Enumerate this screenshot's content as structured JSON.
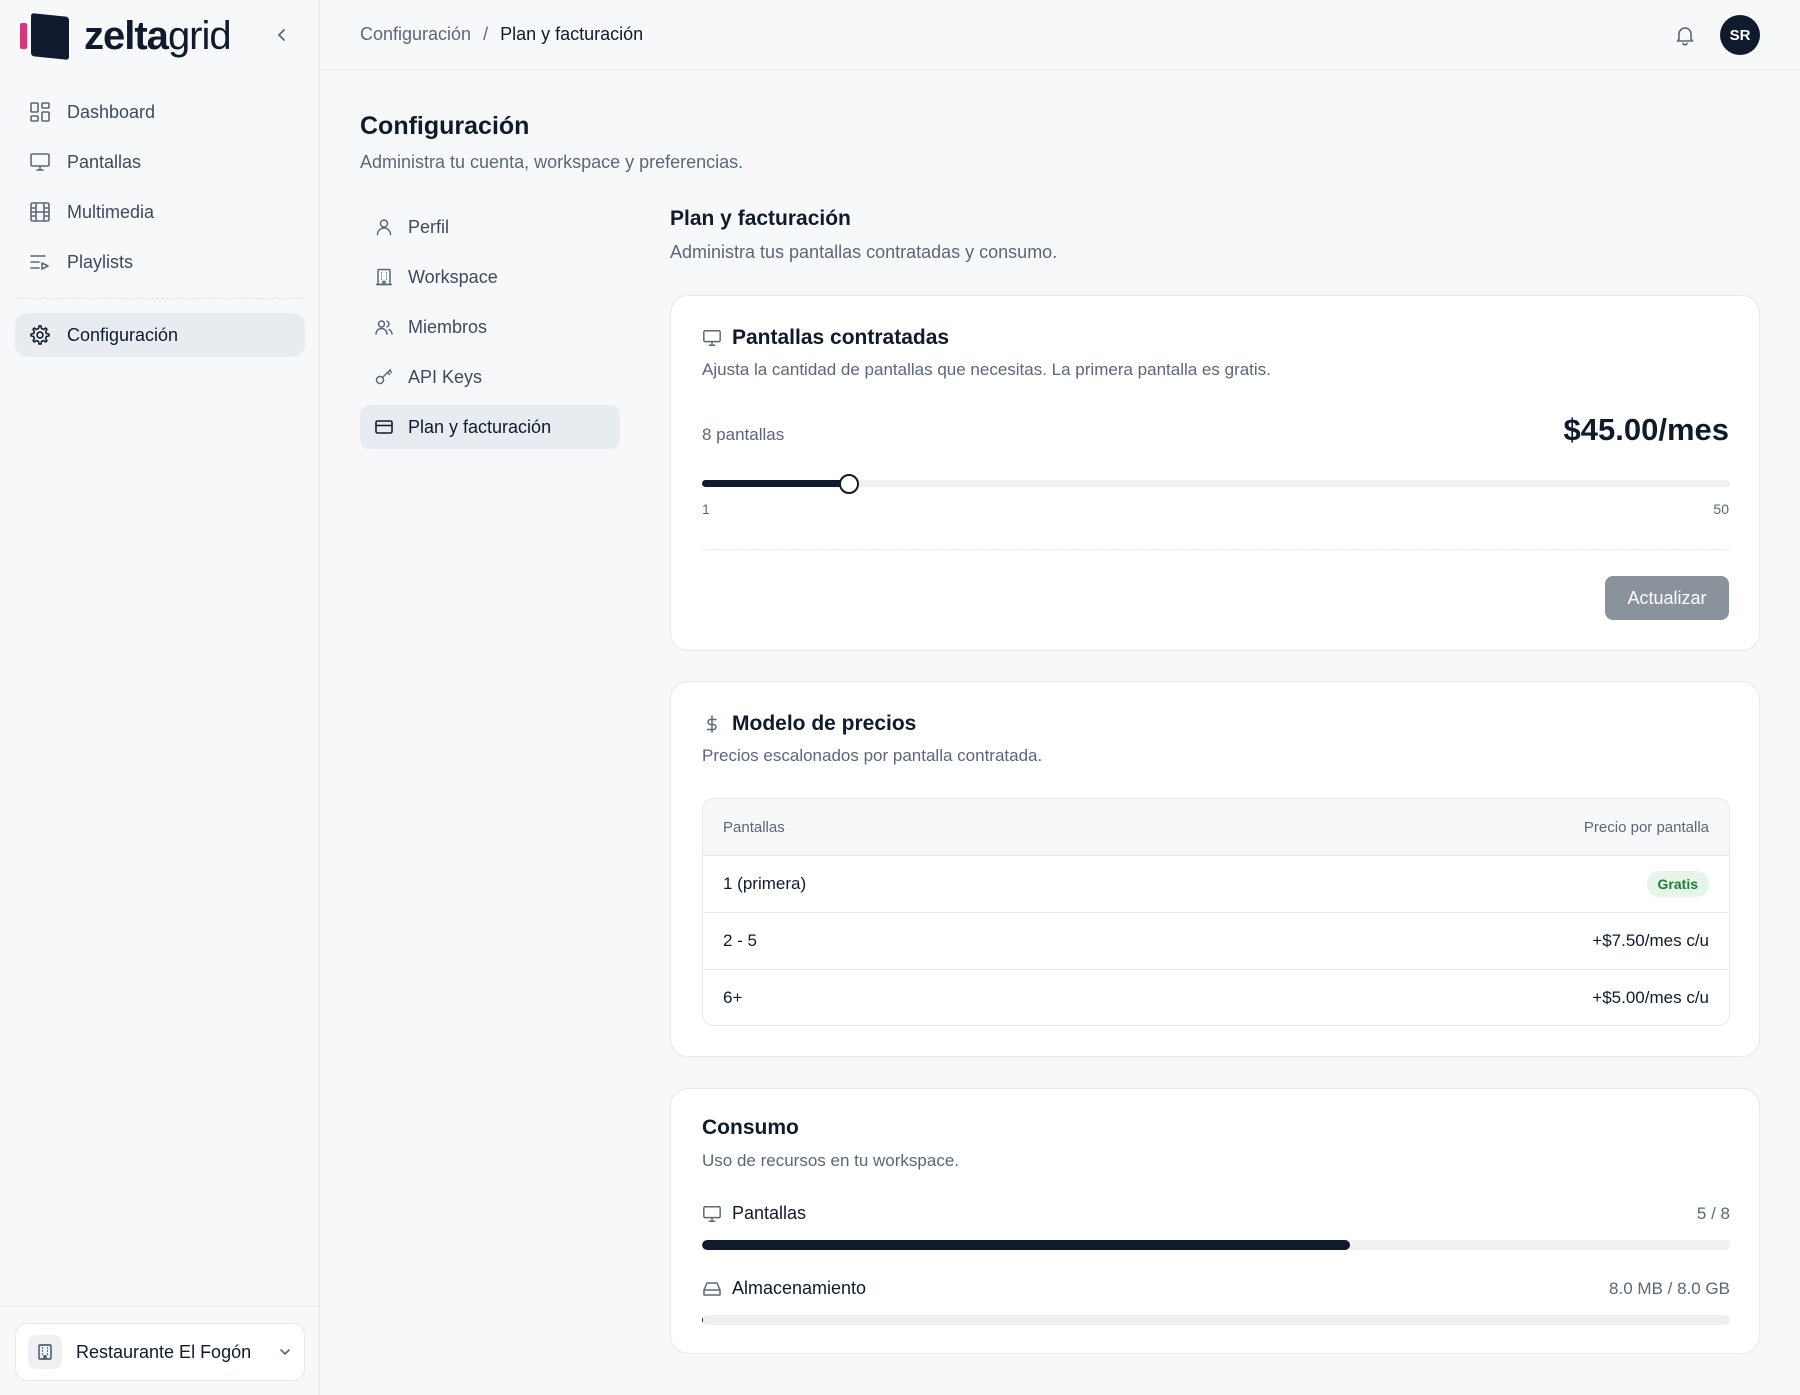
{
  "brand": {
    "name_bold": "zelta",
    "name_light": "grid"
  },
  "sidebar": {
    "items": [
      {
        "label": "Dashboard",
        "icon": "dashboard-icon"
      },
      {
        "label": "Pantallas",
        "icon": "monitor-icon"
      },
      {
        "label": "Multimedia",
        "icon": "film-icon"
      },
      {
        "label": "Playlists",
        "icon": "playlist-icon"
      }
    ],
    "settings": {
      "label": "Configuración",
      "icon": "gear-icon"
    },
    "workspace": "Restaurante El Fogón"
  },
  "header": {
    "breadcrumb": [
      "Configuración",
      "Plan y facturación"
    ],
    "breadcrumb_sep": "/",
    "avatar_initials": "SR"
  },
  "page": {
    "title": "Configuración",
    "subtitle": "Administra tu cuenta, workspace y preferencias."
  },
  "subnav": [
    {
      "label": "Perfil",
      "icon": "user-icon"
    },
    {
      "label": "Workspace",
      "icon": "building-icon"
    },
    {
      "label": "Miembros",
      "icon": "users-icon"
    },
    {
      "label": "API Keys",
      "icon": "key-icon"
    },
    {
      "label": "Plan y facturación",
      "icon": "credit-card-icon",
      "active": true
    }
  ],
  "section": {
    "title": "Plan y facturación",
    "subtitle": "Administra tus pantallas contratadas y consumo."
  },
  "plan_card": {
    "title": "Pantallas contratadas",
    "description": "Ajusta la cantidad de pantallas que necesitas. La primera pantalla es gratis.",
    "count_label": "8 pantallas",
    "price": "$45.00/mes",
    "slider": {
      "min": 1,
      "max": 50,
      "value": 8,
      "min_label": "1",
      "max_label": "50"
    },
    "update_button": "Actualizar"
  },
  "pricing_card": {
    "title": "Modelo de precios",
    "description": "Precios escalonados por pantalla contratada.",
    "columns": [
      "Pantallas",
      "Precio por pantalla"
    ],
    "rows": [
      {
        "range": "1 (primera)",
        "price": "Gratis",
        "badge": true
      },
      {
        "range": "2 - 5",
        "price": "+$7.50/mes c/u"
      },
      {
        "range": "6+",
        "price": "+$5.00/mes c/u"
      }
    ]
  },
  "usage_card": {
    "title": "Consumo",
    "description": "Uso de recursos en tu workspace.",
    "items": [
      {
        "label": "Pantallas",
        "value": "5 / 8",
        "fraction": 0.63
      },
      {
        "label": "Almacenamiento",
        "value": "8.0 MB / 8.0 GB",
        "fraction": 0.001
      }
    ]
  },
  "colors": {
    "primary": "#0f1b2d",
    "accent_pink": "#d6367a",
    "badge_green": "#1f7a3d",
    "button_disabled": "#8a939c"
  }
}
